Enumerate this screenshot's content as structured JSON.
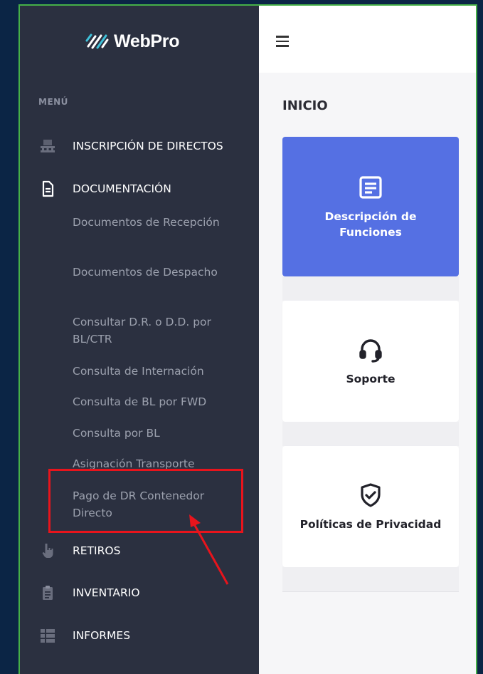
{
  "brand": {
    "name": "WebPro"
  },
  "sidebar": {
    "section_label": "MENÚ",
    "items": [
      {
        "label": "INSCRIPCIÓN DE DIRECTOS",
        "icon": "pallet-icon"
      },
      {
        "label": "DOCUMENTACIÓN",
        "icon": "document-icon"
      },
      {
        "label": "RETIROS",
        "icon": "hand-pointer-icon"
      },
      {
        "label": "INVENTARIO",
        "icon": "clipboard-icon"
      },
      {
        "label": "INFORMES",
        "icon": "list-icon"
      }
    ],
    "sub_items": [
      "Documentos de Recepción",
      "Documentos de Despacho",
      "Consultar D.R. o D.D. por BL/CTR",
      "Consulta de Internación",
      "Consulta de BL por FWD",
      "Consulta por BL",
      "Asignación Transporte",
      "Pago de DR Contenedor Directo"
    ]
  },
  "header": {
    "menu_icon": "hamburger-icon"
  },
  "main": {
    "title": "INICIO",
    "cards": [
      {
        "label": "Descripción de Funciones",
        "icon": "description-icon"
      },
      {
        "label": "Soporte",
        "icon": "headset-icon"
      },
      {
        "label": "Políticas de Privacidad",
        "icon": "shield-check-icon"
      }
    ]
  },
  "colors": {
    "sidebar_bg": "#2b3040",
    "accent_card": "#5570e3",
    "annotation_red": "#e8141c",
    "frame_green": "#46b048"
  }
}
